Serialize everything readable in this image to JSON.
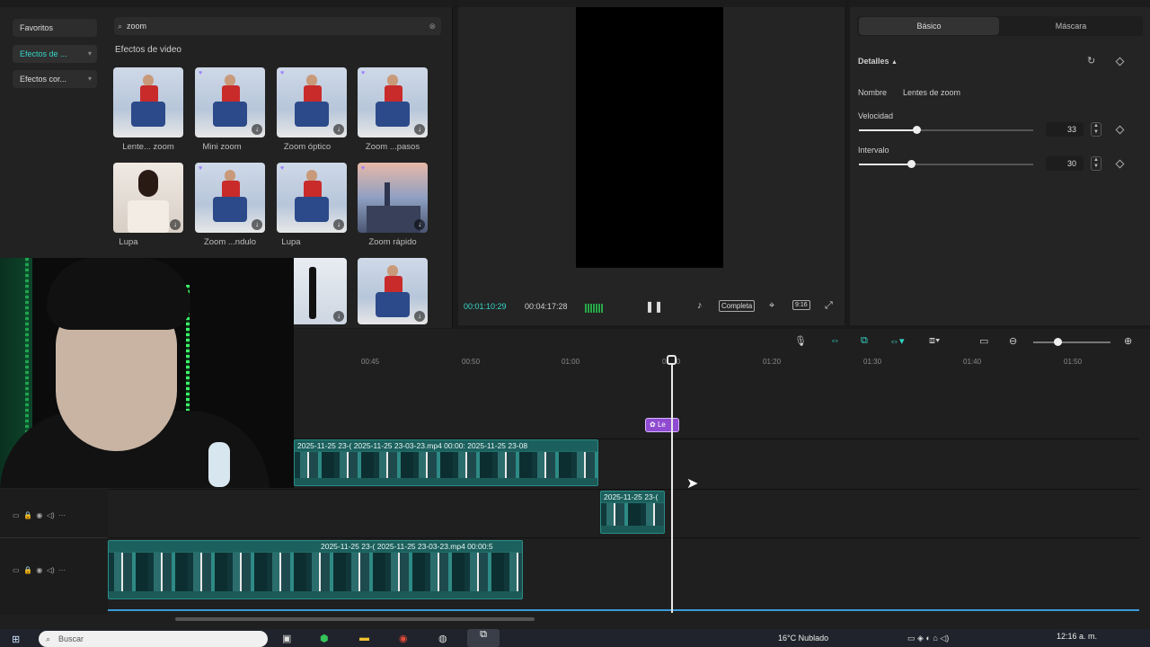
{
  "left_panel": {
    "categories": [
      {
        "label": "Favoritos"
      },
      {
        "label": "Efectos de ..."
      },
      {
        "label": "Efectos cor..."
      }
    ],
    "search": {
      "value": "zoom"
    },
    "section_title": "Efectos de video",
    "effects": [
      {
        "label": "Lente... zoom"
      },
      {
        "label": "Mini zoom"
      },
      {
        "label": "Zoom óptico"
      },
      {
        "label": "Zoom ...pasos"
      },
      {
        "label": "Lupa"
      },
      {
        "label": "Zoom ...ndulo"
      },
      {
        "label": "Lupa"
      },
      {
        "label": "Zoom rápido"
      }
    ]
  },
  "player": {
    "current_time": "00:01:10:29",
    "total_time": "00:04:17:28",
    "complete_label": "Completa"
  },
  "inspector": {
    "tabs": [
      {
        "label": "Básico"
      },
      {
        "label": "Máscara"
      }
    ],
    "section": "Detalles",
    "name_label": "Nombre",
    "name_value": "Lentes de zoom",
    "speed_label": "Velocidad",
    "speed_value": "33",
    "speed_level": 0.33,
    "interval_label": "Intervalo",
    "interval_value": "30",
    "interval_level": 0.3
  },
  "timeline": {
    "ruler": [
      "00:45",
      "00:50",
      "01:00",
      "01:10",
      "01:20",
      "01:30",
      "01:40",
      "01:50"
    ],
    "effect_clip_label": "Le",
    "clips": [
      {
        "title": "2025-11-25 23-(  2025-11-25 23-03-23.mp4  00:00:  2025-11-25 23-08"
      },
      {
        "title": "2025-11-25 23-("
      },
      {
        "title": "2025-11-25 23-(  2025-11-25 23-03-23.mp4  00:00:5"
      }
    ]
  },
  "taskbar": {
    "search_placeholder": "Buscar",
    "weather": "16°C  Nublado",
    "clock": "12:16 a. m."
  },
  "colors": {
    "accent": "#35d7c8",
    "effect_clip": "#8f4bd1",
    "clip": "#1f6f6b"
  }
}
